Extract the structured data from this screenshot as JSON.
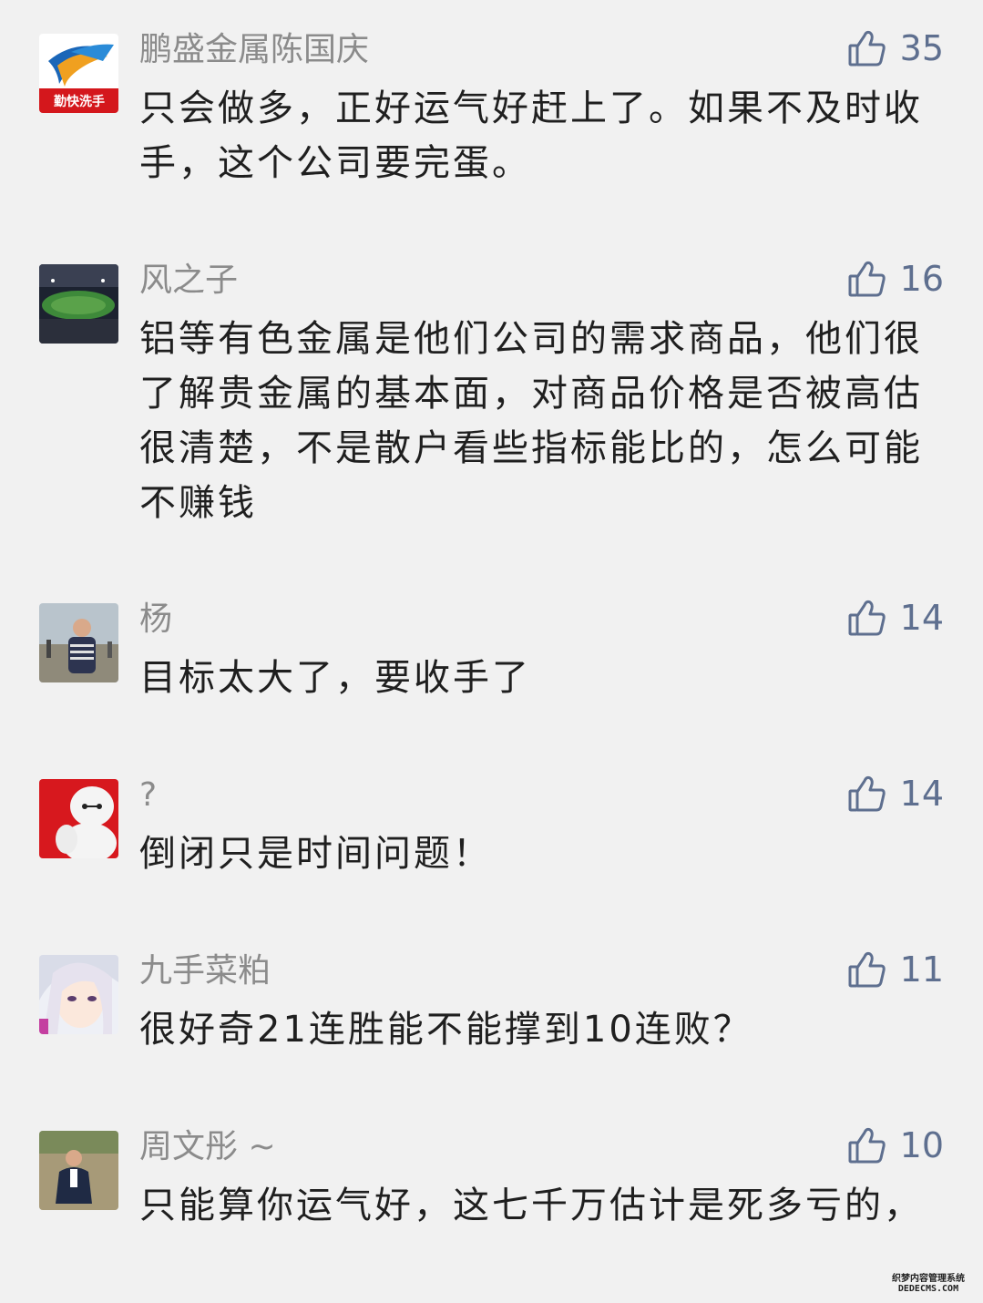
{
  "comments": [
    {
      "name": "鹏盛金属陈国庆",
      "likes": "35",
      "text": "只会做多，正好运气好赶上了。如果不及时收手，这个公司要完蛋。",
      "avatar_icon": "company-logo-avatar",
      "avatar_logo_text": "勤快洗手"
    },
    {
      "name": "风之子",
      "likes": "16",
      "text": "铝等有色金属是他们公司的需求商品，他们很了解贵金属的基本面，对商品价格是否被高估很清楚，不是散户看些指标能比的，怎么可能不赚钱",
      "avatar_icon": "stadium-photo-avatar"
    },
    {
      "name": "杨",
      "likes": "14",
      "text": "目标太大了，要收手了",
      "avatar_icon": "man-photo-avatar"
    },
    {
      "name": "?",
      "likes": "14",
      "text": "倒闭只是时间问题！",
      "avatar_icon": "baymax-avatar"
    },
    {
      "name": "九手菜粕",
      "likes": "11",
      "text": "很好奇21连胜能不能撑到10连败？",
      "avatar_icon": "anime-girl-avatar"
    },
    {
      "name": "周文彤 ~",
      "likes": "10",
      "text": "只能算你运气好，这七千万估计是死多亏的，",
      "avatar_icon": "man-field-photo-avatar"
    }
  ],
  "watermark": {
    "line1": "织梦内容管理系统",
    "line2": "DEDECMS.COM"
  },
  "colors": {
    "background": "#f1f1f1",
    "name": "#8b8b8b",
    "text": "#1f1f1f",
    "like": "#5e6f8f"
  }
}
